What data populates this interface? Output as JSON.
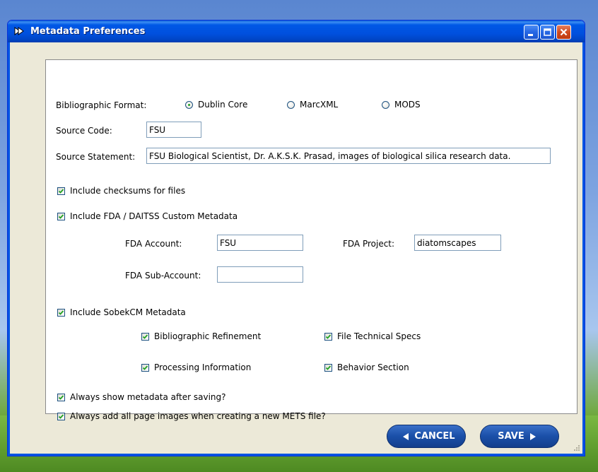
{
  "window": {
    "title": "Metadata Preferences"
  },
  "format": {
    "label": "Bibliographic Format:",
    "options": [
      {
        "label": "Dublin Core",
        "selected": true
      },
      {
        "label": "MarcXML",
        "selected": false
      },
      {
        "label": "MODS",
        "selected": false
      }
    ]
  },
  "source": {
    "code_label": "Source Code:",
    "code_value": "FSU",
    "statement_label": "Source Statement:",
    "statement_value": "FSU Biological Scientist, Dr. A.K.S.K. Prasad, images of biological silica research data."
  },
  "checksums": {
    "label": "Include checksums for files",
    "checked": true
  },
  "fda": {
    "label": "Include FDA / DAITSS Custom Metadata",
    "checked": true,
    "account_label": "FDA Account:",
    "account_value": "FSU",
    "project_label": "FDA Project:",
    "project_value": "diatomscapes",
    "subaccount_label": "FDA Sub-Account:",
    "subaccount_value": ""
  },
  "sobek": {
    "label": "Include SobekCM Metadata",
    "checked": true,
    "biblio_label": "Bibliographic Refinement",
    "file_tech_label": "File Technical Specs",
    "processing_label": "Processing Information",
    "behavior_label": "Behavior Section"
  },
  "always_show": {
    "label": "Always show metadata after saving?",
    "checked": true
  },
  "always_add": {
    "label": "Always add all page images when creating a new METS file?",
    "checked": true
  },
  "buttons": {
    "cancel": "CANCEL",
    "save": "SAVE"
  }
}
